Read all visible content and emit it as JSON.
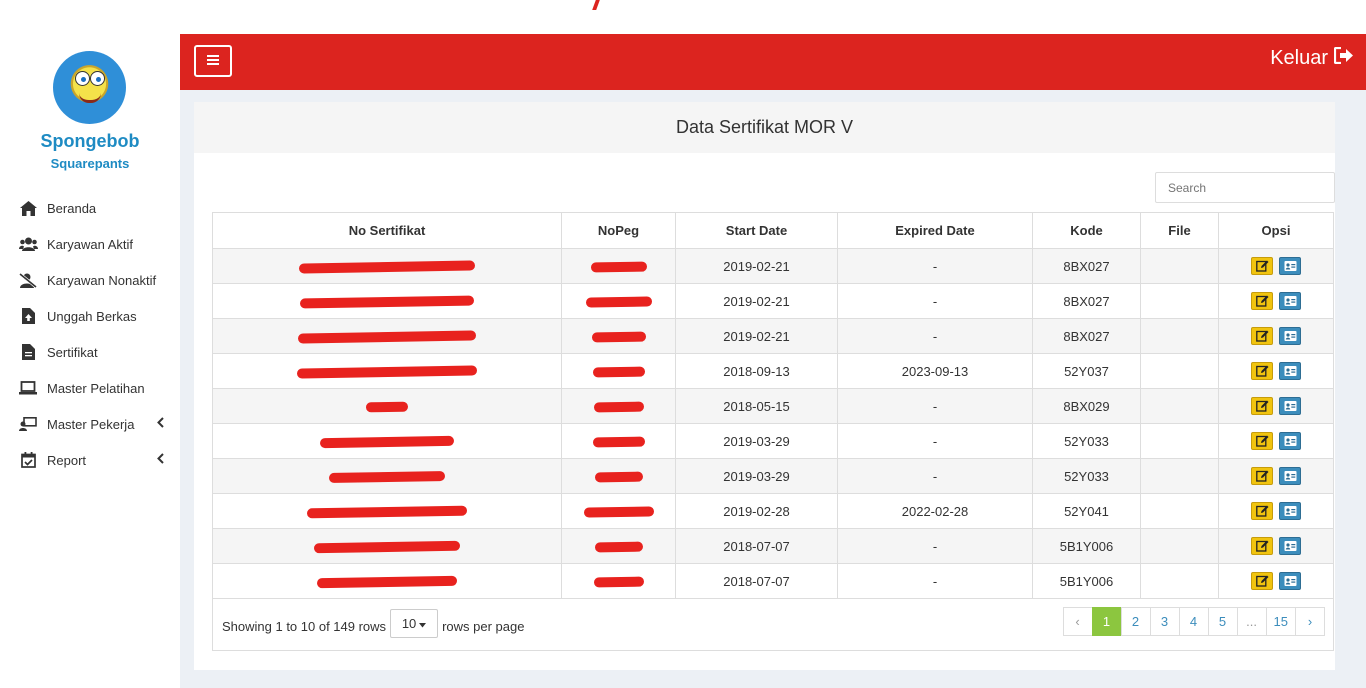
{
  "user": {
    "name": "Spongebob",
    "subtitle": "Squarepants"
  },
  "sidebar": {
    "items": [
      {
        "label": "Beranda",
        "icon": "home-icon"
      },
      {
        "label": "Karyawan Aktif",
        "icon": "users-icon"
      },
      {
        "label": "Karyawan Nonaktif",
        "icon": "user-slash-icon"
      },
      {
        "label": "Unggah Berkas",
        "icon": "file-upload-icon"
      },
      {
        "label": "Sertifikat",
        "icon": "file-icon"
      },
      {
        "label": "Master Pelatihan",
        "icon": "laptop-icon"
      },
      {
        "label": "Master Pekerja",
        "icon": "chalkboard-user-icon",
        "submenu": true
      },
      {
        "label": "Report",
        "icon": "calendar-check-icon",
        "submenu": true
      }
    ]
  },
  "header": {
    "logout_label": "Keluar",
    "accent": "#dc241f"
  },
  "panel": {
    "title": "Data Sertifikat MOR V",
    "search_placeholder": "Search",
    "columns": [
      "No Sertifikat",
      "NoPeg",
      "Start Date",
      "Expired Date",
      "Kode",
      "File",
      "Opsi"
    ],
    "rows": [
      {
        "start": "2019-02-21",
        "expired": "-",
        "kode": "8BX027"
      },
      {
        "start": "2019-02-21",
        "expired": "-",
        "kode": "8BX027"
      },
      {
        "start": "2019-02-21",
        "expired": "-",
        "kode": "8BX027"
      },
      {
        "start": "2018-09-13",
        "expired": "2023-09-13",
        "kode": "52Y037"
      },
      {
        "start": "2018-05-15",
        "expired": "-",
        "kode": "8BX029"
      },
      {
        "start": "2019-03-29",
        "expired": "-",
        "kode": "52Y033"
      },
      {
        "start": "2019-03-29",
        "expired": "-",
        "kode": "52Y033"
      },
      {
        "start": "2019-02-28",
        "expired": "2022-02-28",
        "kode": "52Y041"
      },
      {
        "start": "2018-07-07",
        "expired": "-",
        "kode": "5B1Y006"
      },
      {
        "start": "2018-07-07",
        "expired": "-",
        "kode": "5B1Y006"
      }
    ],
    "footer": {
      "showing_text": "Showing 1 to 10 of 149 rows",
      "per_page_value": "10",
      "per_page_suffix": "rows per page",
      "pages": [
        "‹",
        "1",
        "2",
        "3",
        "4",
        "5",
        "...",
        "15",
        "›"
      ],
      "active_page": "1"
    }
  }
}
